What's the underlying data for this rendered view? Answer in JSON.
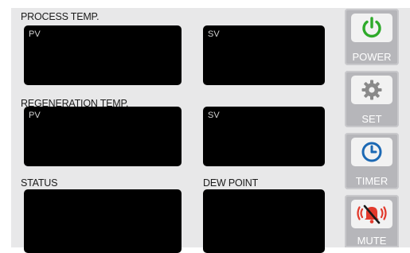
{
  "sections": {
    "process": {
      "title": "PROCESS TEMP.",
      "pv_tag": "PV",
      "sv_tag": "SV"
    },
    "regeneration": {
      "title": "REGENERATION TEMP.",
      "pv_tag": "PV",
      "sv_tag": "SV"
    },
    "status": {
      "title": "STATUS"
    },
    "dew_point": {
      "title": "DEW POINT"
    }
  },
  "buttons": {
    "power": {
      "label": "POWER",
      "icon": "power-icon"
    },
    "set": {
      "label": "SET",
      "icon": "gear-icon"
    },
    "timer": {
      "label": "TIMER",
      "icon": "clock-icon"
    },
    "mute": {
      "label": "MUTE",
      "icon": "alarm-bell-muted-icon"
    }
  },
  "colors": {
    "panel_bg": "#e8e8e9",
    "display_bg": "#000000",
    "button_bg": "#b6b6ba",
    "power_green": "#2eaa2a",
    "gear_gray": "#8a8a8a",
    "timer_blue": "#1c69b4",
    "mute_red": "#e23a2c"
  }
}
